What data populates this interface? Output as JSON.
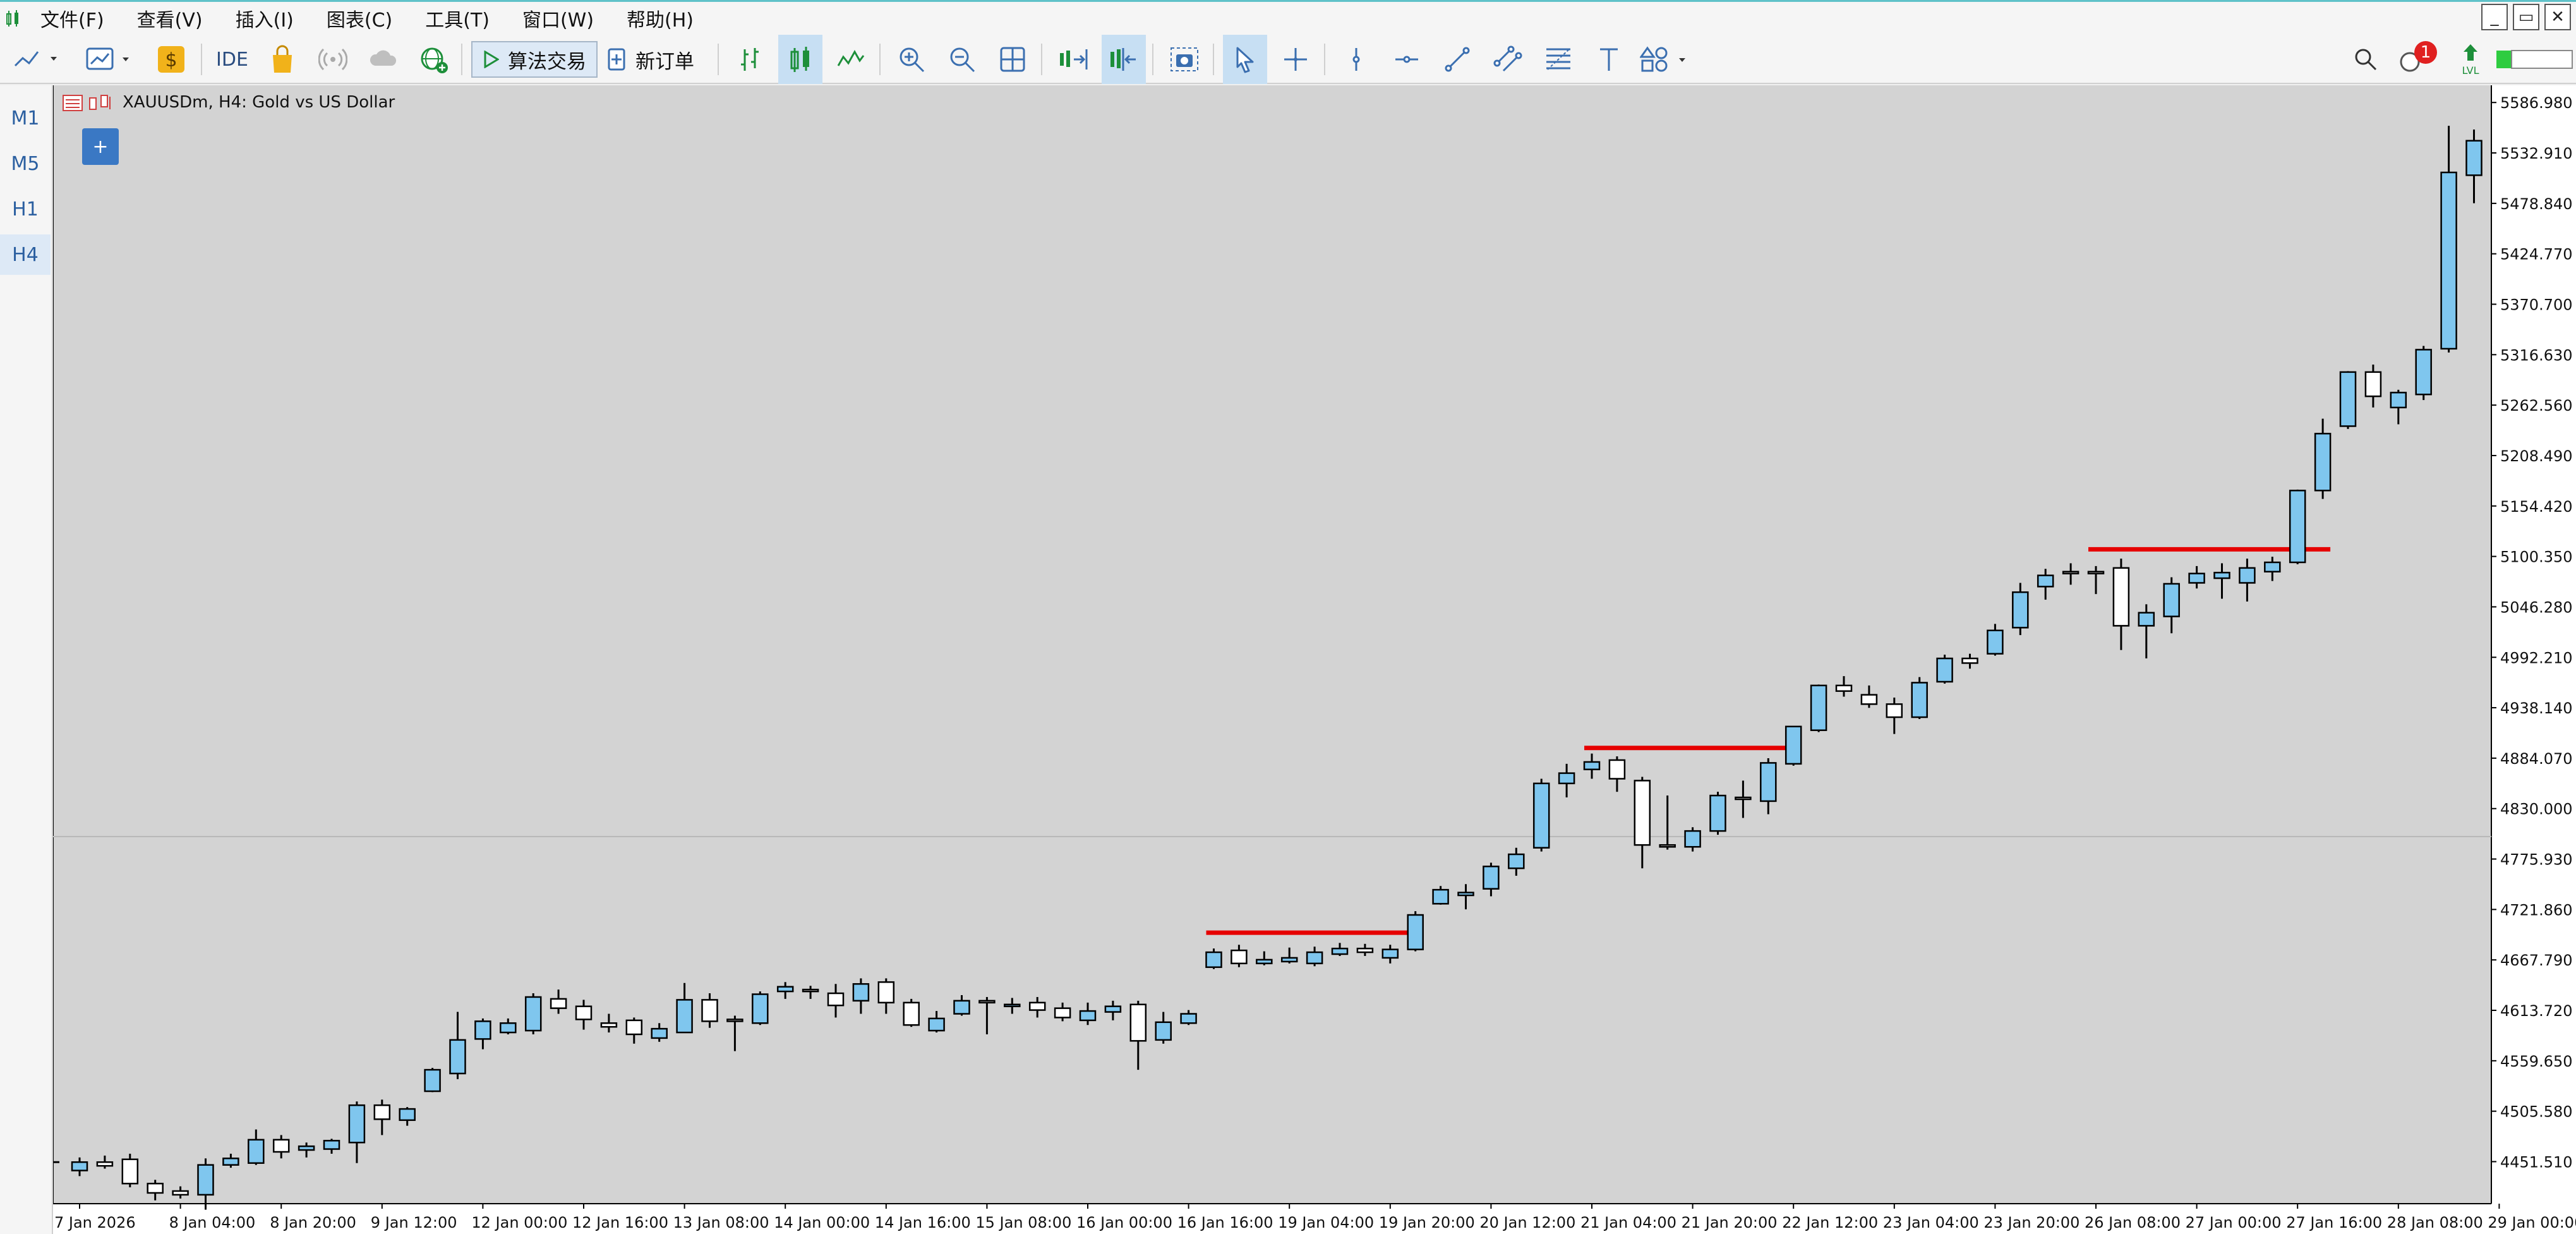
{
  "app": {
    "menu": [
      "文件(F)",
      "查看(V)",
      "插入(I)",
      "图表(C)",
      "工具(T)",
      "窗口(W)",
      "帮助(H)"
    ],
    "window_controls": [
      "_",
      "▭",
      "✕"
    ]
  },
  "toolbar": {
    "ide_label": "IDE",
    "algo_label": "算法交易",
    "new_order_label": "新订单",
    "notification_count": "1",
    "lvl_label": "LVL"
  },
  "timeframes": [
    "M1",
    "M5",
    "H1",
    "H4"
  ],
  "active_timeframe": "H4",
  "chart": {
    "title": "XAUUSDm, H4:  Gold vs US Dollar",
    "plus_label": "+"
  },
  "chart_data": {
    "type": "candlestick",
    "symbol": "XAUUSDm",
    "timeframe": "H4",
    "description": "Gold vs US Dollar",
    "y_ticks": [
      "5586.980",
      "5532.910",
      "5478.840",
      "5424.770",
      "5370.700",
      "5316.630",
      "5262.560",
      "5208.490",
      "5154.420",
      "5100.350",
      "5046.280",
      "4992.210",
      "4938.140",
      "4884.070",
      "4830.000",
      "4775.930",
      "4721.860",
      "4667.790",
      "4613.720",
      "4559.650",
      "4505.580",
      "4451.510"
    ],
    "ylim": [
      4420,
      5600
    ],
    "x_ticks": [
      "7 Jan 2026",
      "8 Jan 04:00",
      "8 Jan 20:00",
      "9 Jan 12:00",
      "12 Jan 00:00",
      "12 Jan 16:00",
      "13 Jan 08:00",
      "14 Jan 00:00",
      "14 Jan 16:00",
      "15 Jan 08:00",
      "16 Jan 00:00",
      "16 Jan 16:00",
      "19 Jan 04:00",
      "19 Jan 20:00",
      "20 Jan 12:00",
      "21 Jan 04:00",
      "21 Jan 20:00",
      "22 Jan 12:00",
      "23 Jan 04:00",
      "23 Jan 20:00",
      "26 Jan 08:00",
      "27 Jan 00:00",
      "27 Jan 16:00",
      "28 Jan 08:00",
      "29 Jan 00:00"
    ],
    "candles": [
      [
        4442,
        4456,
        4436,
        4451
      ],
      [
        4451,
        4458,
        4444,
        4447
      ],
      [
        4454,
        4460,
        4424,
        4428
      ],
      [
        4428,
        4432,
        4410,
        4418
      ],
      [
        4420,
        4425,
        4412,
        4416
      ],
      [
        4416,
        4455,
        4400,
        4448
      ],
      [
        4448,
        4460,
        4445,
        4455
      ],
      [
        4450,
        4486,
        4448,
        4475
      ],
      [
        4475,
        4480,
        4455,
        4462
      ],
      [
        4464,
        4472,
        4456,
        4468
      ],
      [
        4465,
        4476,
        4460,
        4474
      ],
      [
        4472,
        4516,
        4450,
        4512
      ],
      [
        4512,
        4518,
        4480,
        4497
      ],
      [
        4496,
        4510,
        4490,
        4508
      ],
      [
        4527,
        4552,
        4526,
        4550
      ],
      [
        4546,
        4612,
        4540,
        4582
      ],
      [
        4583,
        4605,
        4572,
        4602
      ],
      [
        4590,
        4605,
        4588,
        4600
      ],
      [
        4592,
        4632,
        4588,
        4628
      ],
      [
        4626,
        4636,
        4610,
        4616
      ],
      [
        4618,
        4625,
        4593,
        4604
      ],
      [
        4600,
        4610,
        4590,
        4596
      ],
      [
        4603,
        4606,
        4578,
        4588
      ],
      [
        4584,
        4600,
        4580,
        4594
      ],
      [
        4590,
        4643,
        4590,
        4625
      ],
      [
        4625,
        4632,
        4595,
        4602
      ],
      [
        4604,
        4608,
        4570,
        4602
      ],
      [
        4600,
        4634,
        4598,
        4631
      ],
      [
        4634,
        4644,
        4626,
        4639
      ],
      [
        4636,
        4640,
        4626,
        4635
      ],
      [
        4632,
        4642,
        4606,
        4619
      ],
      [
        4624,
        4648,
        4610,
        4642
      ],
      [
        4644,
        4648,
        4610,
        4622
      ],
      [
        4622,
        4626,
        4596,
        4598
      ],
      [
        4592,
        4613,
        4590,
        4605
      ],
      [
        4610,
        4630,
        4608,
        4624
      ],
      [
        4624,
        4628,
        4588,
        4622
      ],
      [
        4618,
        4627,
        4610,
        4620
      ],
      [
        4622,
        4628,
        4606,
        4614
      ],
      [
        4616,
        4622,
        4602,
        4606
      ],
      [
        4603,
        4622,
        4598,
        4613
      ],
      [
        4612,
        4624,
        4603,
        4618
      ],
      [
        4620,
        4624,
        4550,
        4581
      ],
      [
        4582,
        4612,
        4578,
        4601
      ],
      [
        4600,
        4614,
        4598,
        4610
      ],
      [
        4660,
        4680,
        4658,
        4676
      ],
      [
        4678,
        4684,
        4660,
        4664
      ],
      [
        4664,
        4677,
        4662,
        4668
      ],
      [
        4666,
        4681,
        4664,
        4670
      ],
      [
        4664,
        4682,
        4661,
        4676
      ],
      [
        4674,
        4686,
        4672,
        4680
      ],
      [
        4680,
        4685,
        4672,
        4676
      ],
      [
        4670,
        4684,
        4664,
        4679
      ],
      [
        4679,
        4720,
        4677,
        4716
      ],
      [
        4728,
        4747,
        4727,
        4743
      ],
      [
        4737,
        4749,
        4722,
        4740
      ],
      [
        4744,
        4772,
        4736,
        4768
      ],
      [
        4766,
        4788,
        4758,
        4781
      ],
      [
        4788,
        4862,
        4784,
        4857
      ],
      [
        4857,
        4878,
        4842,
        4868
      ],
      [
        4872,
        4889,
        4862,
        4880
      ],
      [
        4882,
        4886,
        4848,
        4862
      ],
      [
        4860,
        4864,
        4766,
        4791
      ],
      [
        4791,
        4844,
        4786,
        4789
      ],
      [
        4789,
        4810,
        4784,
        4806
      ],
      [
        4806,
        4848,
        4802,
        4844
      ],
      [
        4842,
        4860,
        4820,
        4841
      ],
      [
        4838,
        4884,
        4824,
        4879
      ],
      [
        4878,
        4918,
        4876,
        4918
      ],
      [
        4914,
        4963,
        4912,
        4962
      ],
      [
        4962,
        4972,
        4950,
        4956
      ],
      [
        4952,
        4962,
        4938,
        4942
      ],
      [
        4942,
        4949,
        4910,
        4928
      ],
      [
        4928,
        4971,
        4926,
        4965
      ],
      [
        4966,
        4995,
        4964,
        4991
      ],
      [
        4991,
        4996,
        4980,
        4986
      ],
      [
        4996,
        5028,
        4994,
        5021
      ],
      [
        5024,
        5072,
        5016,
        5062
      ],
      [
        5068,
        5087,
        5054,
        5080
      ],
      [
        5084,
        5093,
        5070,
        5082
      ],
      [
        5084,
        5090,
        5060,
        5082
      ],
      [
        5088,
        5098,
        5000,
        5026
      ],
      [
        5026,
        5049,
        4991,
        5040
      ],
      [
        5036,
        5078,
        5018,
        5071
      ],
      [
        5072,
        5090,
        5066,
        5082
      ],
      [
        5077,
        5093,
        5055,
        5083
      ],
      [
        5072,
        5098,
        5052,
        5088
      ],
      [
        5084,
        5100,
        5074,
        5094
      ],
      [
        5094,
        5172,
        5092,
        5171
      ],
      [
        5171,
        5248,
        5162,
        5232
      ],
      [
        5240,
        5299,
        5237,
        5298
      ],
      [
        5298,
        5306,
        5260,
        5272
      ],
      [
        5260,
        5279,
        5242,
        5276
      ],
      [
        5274,
        5326,
        5268,
        5322
      ],
      [
        5323,
        5562,
        5319,
        5512
      ],
      [
        5509,
        5558,
        5479,
        5546
      ]
    ],
    "resistance_lines": [
      {
        "price": 4697,
        "from_candle": 45,
        "to_candle": 53
      },
      {
        "price": 4895,
        "from_candle": 60,
        "to_candle": 68
      },
      {
        "price": 5108,
        "from_candle": 80,
        "to_candle": 89
      }
    ],
    "colors": {
      "background": "#d3d3d3",
      "bull_fill": "#7fc6ee",
      "bear_fill": "#ffffff",
      "candle_outline": "#000000",
      "resistance_line": "#e60000",
      "crosshair_line": "#b8b8b8"
    }
  }
}
